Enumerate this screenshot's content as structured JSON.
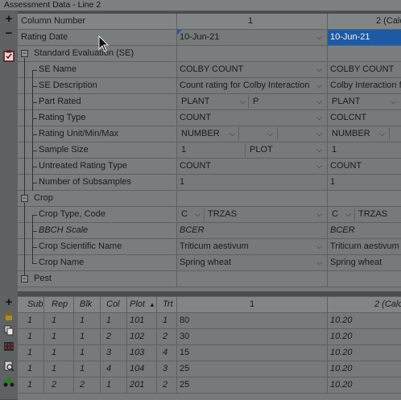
{
  "window_title": "Assessment Data - Line 2",
  "colors": {
    "selection": "#1e5aa4",
    "background": "#777a7a",
    "text": "#1b1b1b"
  },
  "toolbar_top": [
    "add-icon",
    "remove-icon",
    "clipboard-icon"
  ],
  "toolbar_bottom": [
    "add-icon",
    "lock-icon",
    "copy-icon",
    "calendar-icon",
    "search-icon",
    "tractor-icon"
  ],
  "header": {
    "label": "Column Number",
    "col1": "1",
    "col2": "2 (Calc"
  },
  "rating_date": {
    "label": "Rating Date",
    "col1": "10-Jun-21",
    "col2": "10-Jun-21"
  },
  "sections": {
    "se": "Standard Evaluation (SE)",
    "crop": "Crop",
    "pest": "Pest"
  },
  "se_rows": [
    {
      "label": "SE Name",
      "c1a": "COLBY COUNT",
      "c2a": "COLBY COUNT"
    },
    {
      "label": "SE Description",
      "c1a": "Count rating for Colby Interaction",
      "c2a": "Colby Interaction fo"
    },
    {
      "label": "Part Rated",
      "c1a": "PLANT",
      "c1b": "P",
      "c2a": "PLANT"
    },
    {
      "label": "Rating Type",
      "c1a": "COUNT",
      "c2a": "COLCNT"
    },
    {
      "label": "Rating Unit/Min/Max",
      "c1a": "NUMBER",
      "c2a": "NUMBER"
    },
    {
      "label": "Sample Size",
      "c1a": "1",
      "c1b": "PLOT",
      "c2a": "1"
    },
    {
      "label": "Untreated Rating Type",
      "c1a": "COUNT",
      "c2a": "COUNT"
    },
    {
      "label": "Number of Subsamples",
      "c1a": "1",
      "c2a": "1"
    }
  ],
  "crop_rows": [
    {
      "label": "Crop Type, Code",
      "c1a": "C",
      "c1b": "TRZAS",
      "c2a": "C",
      "c2b": "TRZAS"
    },
    {
      "label": "BBCH Scale",
      "c1a": "BCER",
      "c2a": "BCER"
    },
    {
      "label": "Crop Scientific Name",
      "c1a": "Triticum aestivum",
      "c2a": "Triticum aestivum"
    },
    {
      "label": "Crop Name",
      "c1a": "Spring wheat",
      "c2a": "Spring wheat"
    }
  ],
  "plot_table": {
    "columns": [
      "Sub",
      "Rep",
      "Blk",
      "Col",
      "Plot",
      "Trt"
    ],
    "sort_indicator": "▲",
    "col1_header": "1",
    "col2_header": "2 (Calc",
    "rows": [
      {
        "sub": "1",
        "rep": "1",
        "blk": "1",
        "col": "1",
        "plot": "101",
        "trt": "1",
        "v1": "80",
        "v2": "10.20"
      },
      {
        "sub": "1",
        "rep": "1",
        "blk": "1",
        "col": "2",
        "plot": "102",
        "trt": "2",
        "v1": "30",
        "v2": "10.20"
      },
      {
        "sub": "1",
        "rep": "1",
        "blk": "1",
        "col": "3",
        "plot": "103",
        "trt": "4",
        "v1": "15",
        "v2": "10.20"
      },
      {
        "sub": "1",
        "rep": "1",
        "blk": "1",
        "col": "4",
        "plot": "104",
        "trt": "3",
        "v1": "25",
        "v2": "10.20"
      },
      {
        "sub": "1",
        "rep": "2",
        "blk": "2",
        "col": "1",
        "plot": "201",
        "trt": "2",
        "v1": "25",
        "v2": "10.20"
      }
    ]
  }
}
